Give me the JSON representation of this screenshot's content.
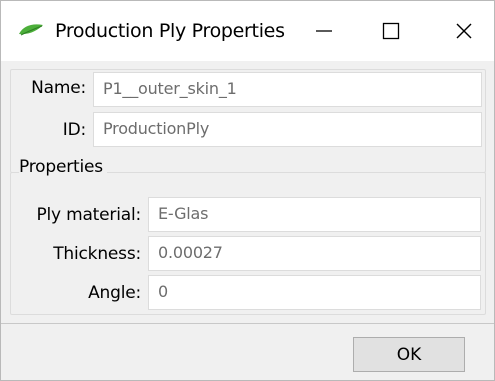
{
  "window": {
    "title": "Production Ply Properties"
  },
  "fields": {
    "name_label": "Name:",
    "name_value": "P1__outer_skin_1",
    "id_label": "ID:",
    "id_value": "ProductionPly"
  },
  "properties": {
    "group_title": "Properties",
    "ply_material_label": "Ply material:",
    "ply_material_value": "E-Glas",
    "thickness_label": "Thickness:",
    "thickness_value": "0.00027",
    "angle_label": "Angle:",
    "angle_value": "0"
  },
  "footer": {
    "ok_label": "OK"
  },
  "icons": {
    "app": "green-ply-icon",
    "minimize": "minimize-icon",
    "maximize": "maximize-icon",
    "close": "close-icon"
  },
  "colors": {
    "app_icon": "#4caf3a",
    "field_text": "#6d6d6d"
  }
}
